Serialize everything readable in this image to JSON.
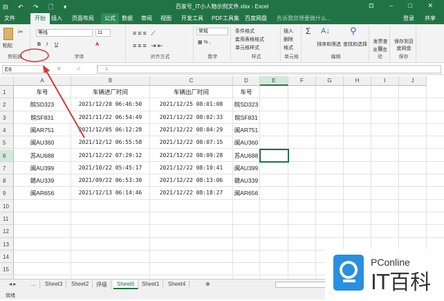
{
  "window": {
    "title": "百家号_IT小人物示例文件.xlsx - Excel",
    "quick_access": "⊟ ↶ ↷ 🗋 ▾",
    "controls": "⊡ – □ ✕"
  },
  "tabs": [
    "文件",
    "开始",
    "插入",
    "页面布局",
    "公式",
    "数据",
    "审阅",
    "视图",
    "开发工具",
    "PDF工具集",
    "百度网盘"
  ],
  "search_placeholder": "告诉我您想要做什么...",
  "login": "登录",
  "share": "共享",
  "ribbon": {
    "paste": "粘贴",
    "clipboard": "剪贴板",
    "font_name": "等线",
    "font_size": "11",
    "font": "字体",
    "bold": "B",
    "italic": "I",
    "underline": "U",
    "alignment": "对齐方式",
    "number_format": "常规",
    "number": "数字",
    "conditional": "条件格式",
    "table_format": "套用表格格式",
    "cell_style": "单元格样式",
    "styles": "样式",
    "insert": "插入",
    "delete": "删除",
    "format": "格式",
    "cells": "单元格",
    "sort_filter": "排序和筛选",
    "find_select": "查找和选择",
    "editing": "编辑",
    "invoice_check": "发票查验",
    "invoice_group": "发票查验",
    "save_baidu": "保存到百度网盘",
    "save_group": "保存"
  },
  "formula_bar": {
    "name_box": "E6",
    "fx": "✕ ✓ fx",
    "value": ""
  },
  "columns": [
    "A",
    "B",
    "C",
    "D",
    "E",
    "F",
    "G",
    "H",
    "I",
    "J"
  ],
  "headers": [
    "车号",
    "车辆进厂时间",
    "车辆出厂时间",
    "车号"
  ],
  "rows": [
    [
      "皖SD323",
      "2021/12/20 06:46:50",
      "2021/12/25 08:01:08",
      "皖SD323"
    ],
    [
      "皖SF831",
      "2021/11/22 06:54:49",
      "2021/12/22 08:02:33",
      "皖SF831"
    ],
    [
      "闽AR751",
      "2021/12/05 06:12:28",
      "2021/12/22 08:04:29",
      "闽AR751"
    ],
    [
      "闽AU360",
      "2021/12/12 06:55:58",
      "2021/12/22 08:07:15",
      "闽AU360"
    ],
    [
      "苏AU688",
      "2021/12/22 07:29:12",
      "2021/12/22 08:09:28",
      "苏AU688"
    ],
    [
      "闽AU399",
      "2021/10/22 05:45:17",
      "2021/12/22 08:10:41",
      "闽AU399"
    ],
    [
      "赣AU339",
      "2021/09/22 06:53:30",
      "2021/12/22 08:13:06",
      "赣AU339"
    ],
    [
      "闽AR656",
      "2021/12/13 06:14:46",
      "2021/12/22 08:18:27",
      "闽AR656"
    ]
  ],
  "sheets": [
    "...",
    "Sheet3",
    "Sheet2",
    "评级",
    "Sheet6",
    "Sheet1",
    "Sheet4"
  ],
  "active_sheet": "Sheet6",
  "status": "就绪",
  "watermark": {
    "brand": "PConline",
    "name": "IT百科"
  }
}
